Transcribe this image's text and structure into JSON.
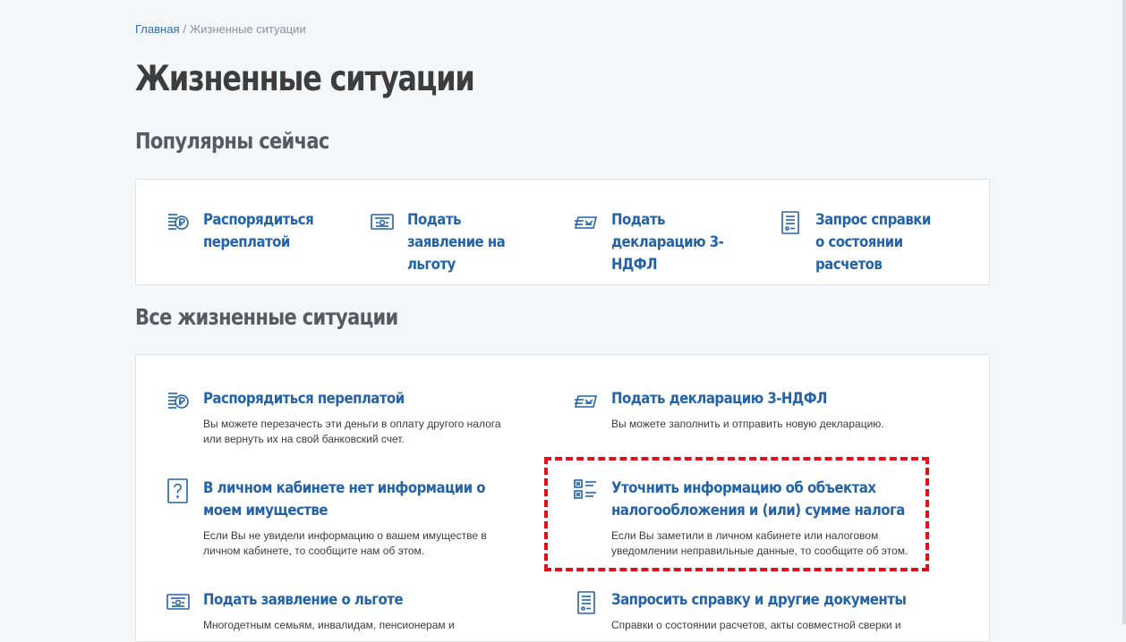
{
  "breadcrumb": {
    "home": "Главная",
    "separator": "/",
    "current": "Жизненные ситуации"
  },
  "page_title": "Жизненные ситуации",
  "popular": {
    "title": "Популярны сейчас",
    "items": [
      {
        "icon": "coins-ruble-icon",
        "label": "Распорядиться переплатой"
      },
      {
        "icon": "certificate-icon",
        "label": "Подать заявление на льготу"
      },
      {
        "icon": "banknotes-icon",
        "label": "Подать декларацию 3-НДФЛ"
      },
      {
        "icon": "document-list-icon",
        "label": "Запрос справки о состоянии расчетов"
      }
    ]
  },
  "all": {
    "title": "Все жизненные ситуации",
    "items": [
      {
        "icon": "coins-ruble-icon",
        "label": "Распорядиться переплатой",
        "desc": "Вы можете перезачесть эти деньги в оплату другого налога или вернуть их на свой банковский счет."
      },
      {
        "icon": "banknotes-icon",
        "label": "Подать декларацию 3-НДФЛ",
        "desc": "Вы можете заполнить и отправить новую декларацию."
      },
      {
        "icon": "question-icon",
        "label": "В личном кабинете нет информации о моем имуществе",
        "desc": "Если Вы не увидели информацию о вашем имуществе в личном кабинете, то сообщите нам об этом."
      },
      {
        "icon": "checklist-icon",
        "label": "Уточнить информацию об объектах налогообложения и (или) сумме налога",
        "desc": "Если Вы заметили в личном кабинете или налоговом уведомлении неправильные данные, то сообщите об этом."
      },
      {
        "icon": "certificate-icon",
        "label": "Подать заявление о льготе",
        "desc": "Многодетным семьям, инвалидам, пенсионерам и"
      },
      {
        "icon": "document-list-icon",
        "label": "Запросить справку и другие документы",
        "desc": "Справки о состоянии расчетов, акты совместной сверки и"
      }
    ]
  },
  "colors": {
    "link": "#2463a8",
    "highlight": "#e3101a",
    "background": "#f3f7fa"
  }
}
